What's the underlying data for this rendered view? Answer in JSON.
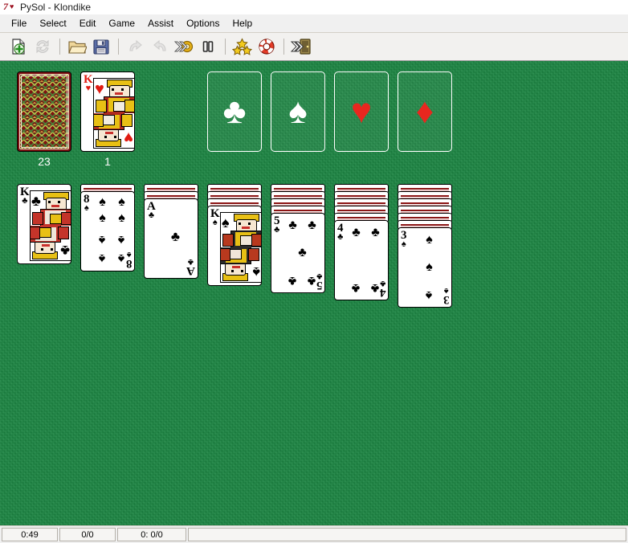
{
  "window": {
    "title": "PySol - Klondike",
    "icon": "pysol-seven-hearts-icon"
  },
  "menubar": {
    "items": [
      {
        "label": "File",
        "name": "menu-file"
      },
      {
        "label": "Select",
        "name": "menu-select"
      },
      {
        "label": "Edit",
        "name": "menu-edit"
      },
      {
        "label": "Game",
        "name": "menu-game"
      },
      {
        "label": "Assist",
        "name": "menu-assist"
      },
      {
        "label": "Options",
        "name": "menu-options"
      },
      {
        "label": "Help",
        "name": "menu-help"
      }
    ]
  },
  "toolbar": {
    "buttons": [
      {
        "icon": "new-game-icon",
        "name": "new-game-button",
        "enabled": true
      },
      {
        "icon": "restart-icon",
        "name": "restart-button",
        "enabled": false
      },
      {
        "icon": "open-folder-icon",
        "name": "open-button",
        "enabled": true
      },
      {
        "icon": "save-floppy-icon",
        "name": "save-button",
        "enabled": true
      },
      {
        "icon": "undo-arrow-icon",
        "name": "undo-button",
        "enabled": false
      },
      {
        "icon": "redo-arrow-icon",
        "name": "redo-button",
        "enabled": false
      },
      {
        "icon": "autodrop-icon",
        "name": "autodrop-button",
        "enabled": true
      },
      {
        "icon": "pause-icon",
        "name": "pause-button",
        "enabled": true
      },
      {
        "icon": "hint-stars-icon",
        "name": "hint-button",
        "enabled": true
      },
      {
        "icon": "help-lifebuoy-icon",
        "name": "help-button",
        "enabled": true
      },
      {
        "icon": "quit-door-icon",
        "name": "quit-button",
        "enabled": true
      }
    ]
  },
  "game": {
    "name": "Klondike",
    "felt_color": "#17853f",
    "card_back_color": "#7d1313",
    "stock": {
      "count_label": "23",
      "face_down": true
    },
    "waste": {
      "count_label": "1",
      "top_card": {
        "rank": "K",
        "suit": "hearts",
        "color": "red"
      }
    },
    "foundations": [
      {
        "suit": "clubs",
        "symbol": "♣",
        "color": "#ffffff",
        "name": "foundation-clubs",
        "cards": []
      },
      {
        "suit": "spades",
        "symbol": "♠",
        "color": "#ffffff",
        "name": "foundation-spades",
        "cards": []
      },
      {
        "suit": "hearts",
        "symbol": "♥",
        "color": "#e8271f",
        "name": "foundation-hearts",
        "cards": []
      },
      {
        "suit": "diamonds",
        "symbol": "♦",
        "color": "#e8271f",
        "name": "foundation-diamonds",
        "cards": []
      }
    ],
    "tableau": [
      {
        "index": 1,
        "face_down": 0,
        "top_card": {
          "rank": "K",
          "suit": "clubs",
          "color": "black"
        }
      },
      {
        "index": 2,
        "face_down": 1,
        "top_card": {
          "rank": "8",
          "suit": "spades",
          "color": "black"
        }
      },
      {
        "index": 3,
        "face_down": 2,
        "top_card": {
          "rank": "A",
          "suit": "clubs",
          "color": "black"
        }
      },
      {
        "index": 4,
        "face_down": 3,
        "top_card": {
          "rank": "K",
          "suit": "spades",
          "color": "black"
        }
      },
      {
        "index": 5,
        "face_down": 4,
        "top_card": {
          "rank": "5",
          "suit": "clubs",
          "color": "black"
        }
      },
      {
        "index": 6,
        "face_down": 5,
        "top_card": {
          "rank": "4",
          "suit": "clubs",
          "color": "black"
        }
      },
      {
        "index": 7,
        "face_down": 6,
        "top_card": {
          "rank": "3",
          "suit": "spades",
          "color": "black"
        }
      }
    ]
  },
  "statusbar": {
    "time": "0:49",
    "moves": "0/0",
    "stats": "0: 0/0",
    "message": ""
  }
}
